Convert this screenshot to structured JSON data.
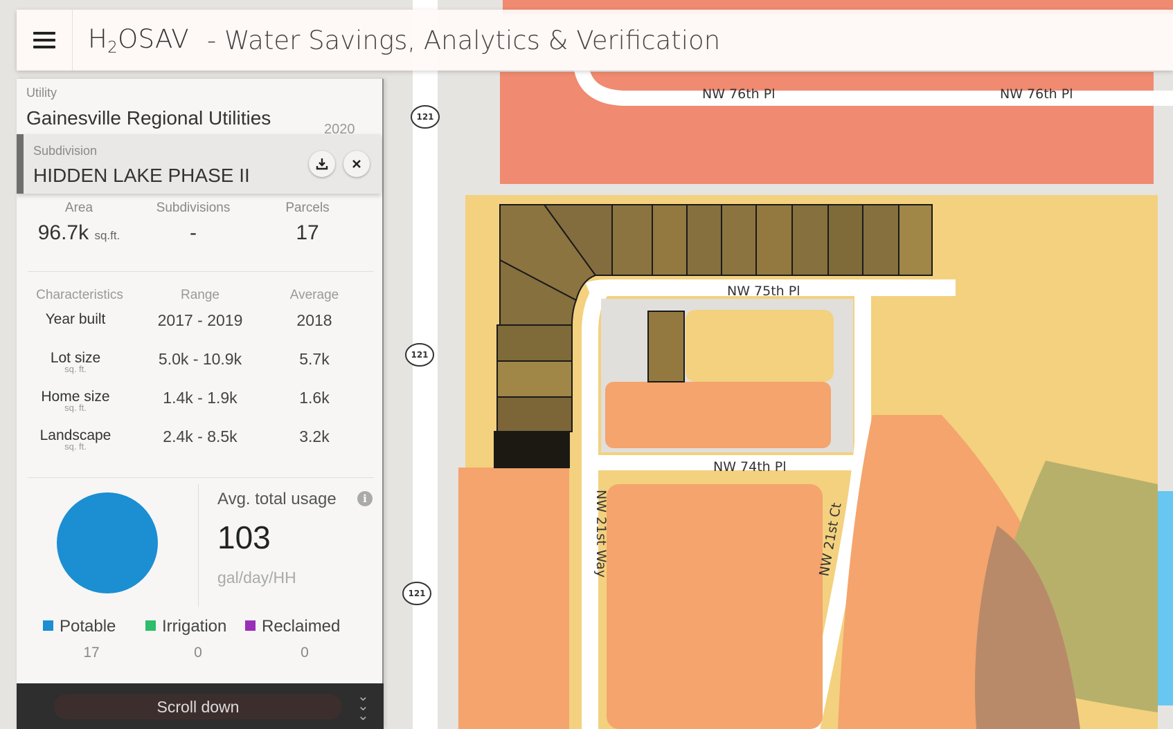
{
  "app": {
    "title_main": "H",
    "title_sub": "2",
    "title_rest": "OSAV",
    "subtitle": "- Water Savings, Analytics & Verification"
  },
  "utility": {
    "label": "Utility",
    "value": "Gainesville Regional Utilities",
    "year": "2020"
  },
  "subdivision": {
    "label": "Subdivision",
    "value": "HIDDEN LAKE PHASE II"
  },
  "stats": [
    {
      "header": "Area",
      "value": "96.7k",
      "unit": "sq.ft."
    },
    {
      "header": "Subdivisions",
      "value": "-",
      "unit": ""
    },
    {
      "header": "Parcels",
      "value": "17",
      "unit": ""
    }
  ],
  "characteristics": {
    "headers": [
      "Characteristics",
      "Range",
      "Average"
    ],
    "rows": [
      {
        "name": "Year built",
        "unit": "",
        "range": "2017 - 2019",
        "average": "2018"
      },
      {
        "name": "Lot size",
        "unit": "sq. ft.",
        "range": "5.0k - 10.9k",
        "average": "5.7k"
      },
      {
        "name": "Home size",
        "unit": "sq. ft.",
        "range": "1.4k - 1.9k",
        "average": "1.6k"
      },
      {
        "name": "Landscape",
        "unit": "sq. ft.",
        "range": "2.4k - 8.5k",
        "average": "3.2k"
      }
    ]
  },
  "usage": {
    "label": "Avg. total usage",
    "value": "103",
    "unit": "gal/day/HH",
    "pie_color": "#1b8fd2"
  },
  "legend": [
    {
      "name": "Potable",
      "value": "17",
      "color": "#1b8fd2"
    },
    {
      "name": "Irrigation",
      "value": "0",
      "color": "#2ebd6b"
    },
    {
      "name": "Reclaimed",
      "value": "0",
      "color": "#9b30b8"
    }
  ],
  "scroll": {
    "label": "Scroll down"
  },
  "map": {
    "roads": [
      "NW 76th Pl",
      "NW 76th Pl",
      "NW 75th Pl",
      "NW 74th Pl",
      "NW 21st Way",
      "NW 21st Ct"
    ],
    "shields": [
      "121",
      "121",
      "121"
    ]
  }
}
